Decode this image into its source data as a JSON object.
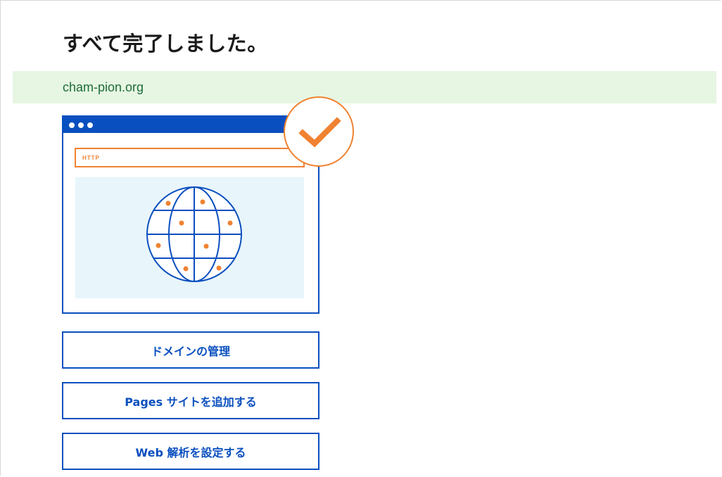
{
  "header": {
    "title": "すべて完了しました。"
  },
  "domain": {
    "name": "cham-pion.org"
  },
  "illustration": {
    "address_bar_label": "HTTP",
    "icons": [
      "browser-window-icon",
      "globe-icon",
      "check-badge-icon"
    ],
    "colors": {
      "primary": "#0a4fbf",
      "accent": "#f08231",
      "panel": "#e8f5fb"
    }
  },
  "actions": {
    "manage_domain": "ドメインの管理",
    "add_pages_site": "Pages サイトを追加する",
    "setup_web_analytics": "Web 解析を設定する"
  }
}
